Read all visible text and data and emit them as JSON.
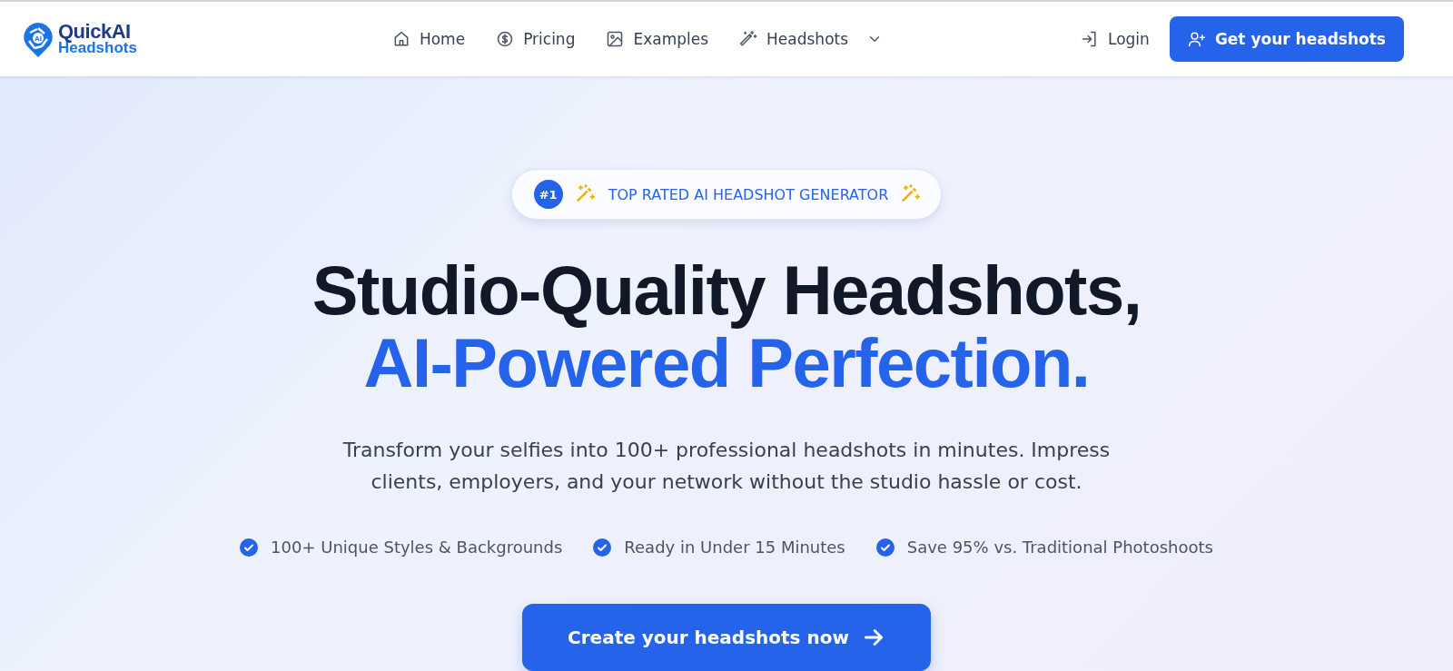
{
  "logo": {
    "line_1": "QuickAI",
    "line_2": "Headshots",
    "mark": "AI"
  },
  "nav": [
    {
      "label": "Home"
    },
    {
      "label": "Pricing"
    },
    {
      "label": "Examples"
    },
    {
      "label": "Headshots",
      "dropdown": true
    }
  ],
  "login": "Login",
  "cta_header": "Get your headshots",
  "badge": {
    "rank": "#1",
    "text": "TOP RATED AI HEADSHOT GENERATOR"
  },
  "title_line_1": "Studio-Quality Headshots,",
  "title_line_2": "AI-Powered Perfection.",
  "subtitle": "Transform your selfies into 100+ professional headshots in minutes. Impress clients, employers, and your network without the studio hassle or cost.",
  "features": [
    "100+ Unique Styles & Backgrounds",
    "Ready in Under 15 Minutes",
    "Save 95% vs. Traditional Photoshoots"
  ],
  "cta_main": "Create your headshots now"
}
